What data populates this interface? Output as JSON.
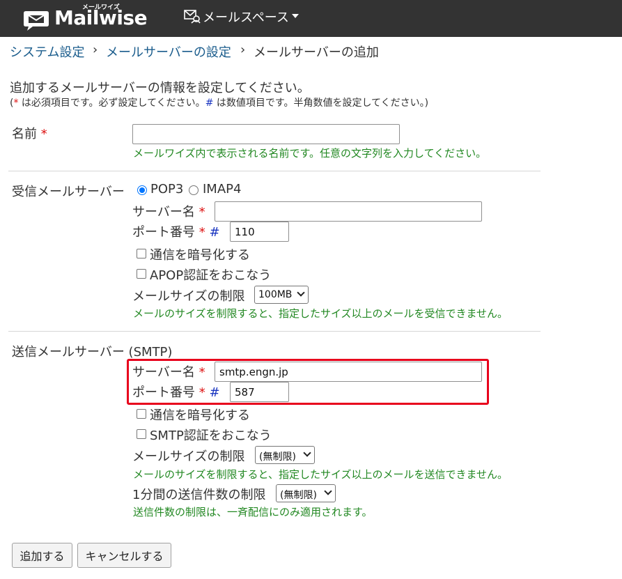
{
  "header": {
    "logo_kana": "メールワイズ",
    "logo_text": "Mailwise",
    "space_menu_label": "メールスペース"
  },
  "breadcrumb": {
    "items": [
      "システム設定",
      "メールサーバーの設定"
    ],
    "separator": "›",
    "current": "メールサーバーの追加"
  },
  "intro": {
    "text": "追加するメールサーバーの情報を設定してください。",
    "note_open": "(",
    "required_mark": "*",
    "note_required": " は必須項目です。必ず設定してください。",
    "numeric_mark": "#",
    "note_numeric": " は数値項目です。半角数値を設定してください。)"
  },
  "name_section": {
    "label": "名前",
    "value": "",
    "help": "メールワイズ内で表示される名前です。任意の文字列を入力してください。"
  },
  "incoming": {
    "label": "受信メールサーバー",
    "protocols": [
      {
        "label": "POP3",
        "selected": true
      },
      {
        "label": "IMAP4",
        "selected": false
      }
    ],
    "server_label": "サーバー名",
    "server_value": "",
    "port_label": "ポート番号",
    "port_value": "110",
    "encrypt_label": "通信を暗号化する",
    "apop_label": "APOP認証をおこなう",
    "size_label": "メールサイズの制限",
    "size_value": "100MB",
    "help": "メールのサイズを制限すると、指定したサイズ以上のメールを受信できません。"
  },
  "outgoing": {
    "label": "送信メールサーバー (SMTP)",
    "server_label": "サーバー名",
    "server_value": "smtp.engn.jp",
    "port_label": "ポート番号",
    "port_value": "587",
    "encrypt_label": "通信を暗号化する",
    "auth_label": "SMTP認証をおこなう",
    "size_label": "メールサイズの制限",
    "size_value": "(無制限)",
    "size_help": "メールのサイズを制限すると、指定したサイズ以上のメールを送信できません。",
    "rate_label": "1分間の送信件数の制限",
    "rate_value": "(無制限)",
    "rate_help": "送信件数の制限は、一斉配信にのみ適用されます。"
  },
  "buttons": {
    "add": "追加する",
    "cancel": "キャンセルする"
  },
  "colors": {
    "header_bg": "#333333",
    "link": "#1a5c8c",
    "required": "#dd1111",
    "numeric": "#1a35c0",
    "help_text": "#228822",
    "highlight": "#e8001c"
  }
}
